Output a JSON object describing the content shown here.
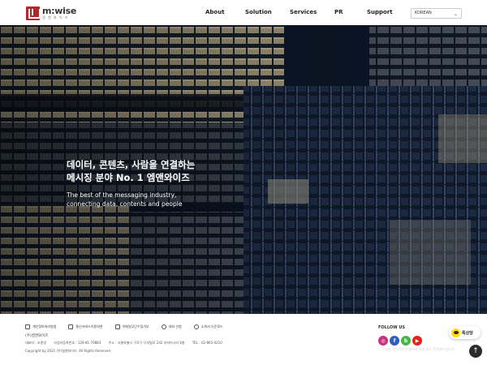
{
  "header": {
    "logo_en": "m:wise",
    "logo_ko": "엠 앤 와 이 즈",
    "nav": [
      "About",
      "Solution",
      "Services",
      "PR",
      "Support"
    ],
    "language": "KOREAN"
  },
  "hero": {
    "title_line1": "데이터, 콘텐츠, 사람을 연결하는",
    "title_line2": "메시징 분야 No. 1 엠앤와이즈",
    "sub_line1": "The best of the messaging industry,",
    "sub_line2": "connecting data, contents and people"
  },
  "footer": {
    "policies": [
      "개인정보처리방침",
      "통신서비스이용약관",
      "이메일무단수집거부",
      "대외 신청",
      "소개서 다운로드"
    ],
    "company": "(주)엠앤와이즈",
    "address_parts": [
      "대표자 : 조종영",
      "사업자등록번호 : 129-81-70883",
      "주소 : 서울특별시 구로구 디지털로 242 지하이시티 6층",
      "TEL : 02-865-4210"
    ],
    "copyright": "Copyright by 2021 (주)엠앤와이즈. All Rights Reserved.",
    "follow_label": "FOLLOW US",
    "social": [
      "instagram",
      "facebook",
      "band",
      "youtube"
    ],
    "faint_note": "다음 기간 동안 이용하지 않을 경우 휴면처리 됩니다"
  },
  "floating": {
    "kakao_label": "톡상담",
    "top_arrow": "↑"
  }
}
